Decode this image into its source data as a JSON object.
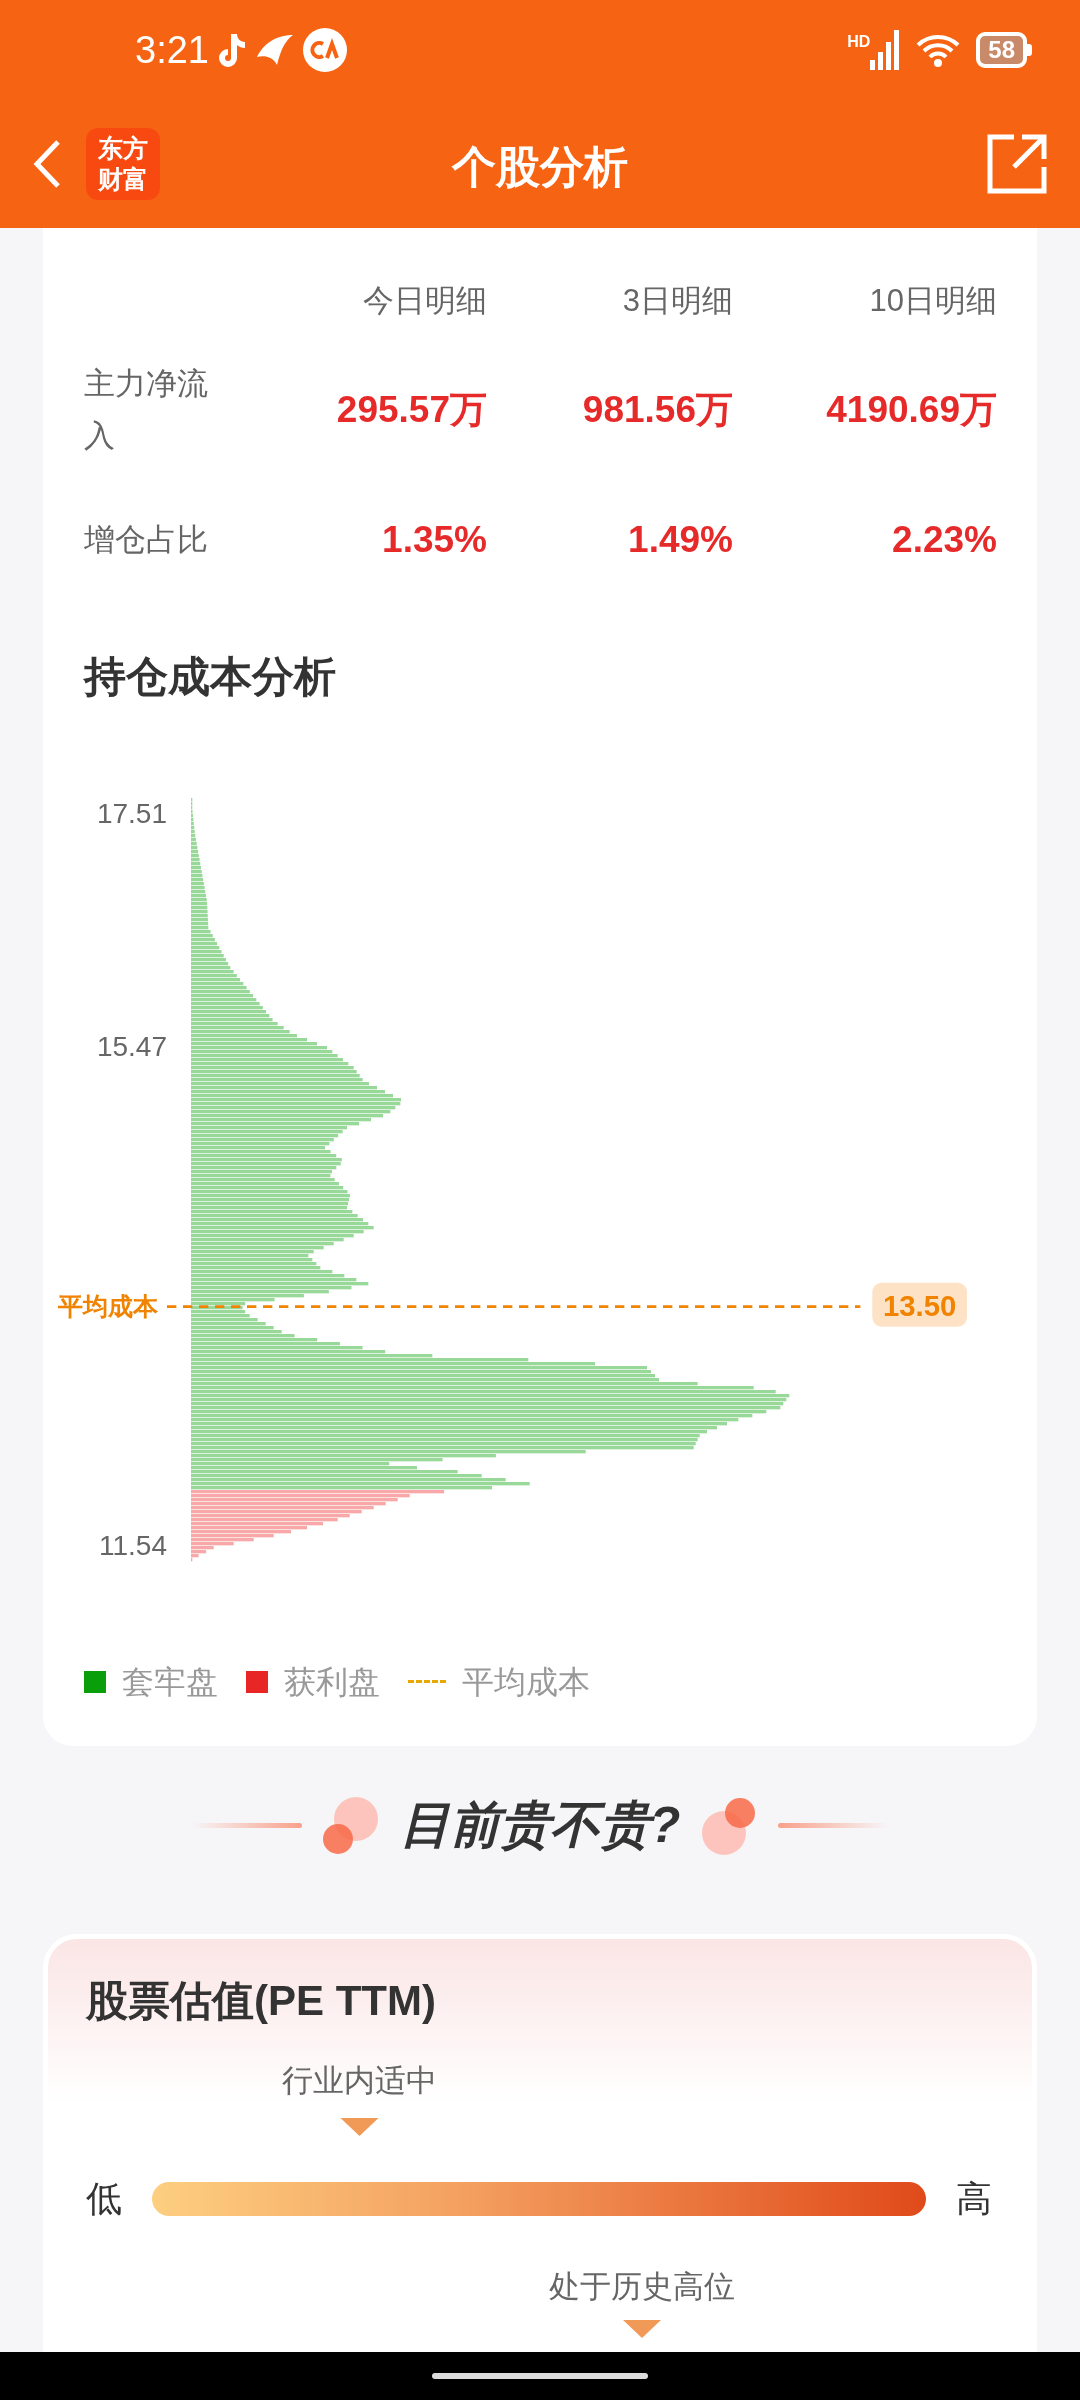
{
  "status_bar": {
    "time": "3:21",
    "network": "HD",
    "battery": "58"
  },
  "header": {
    "logo": "东方财富",
    "title": "个股分析"
  },
  "fund_flow": {
    "columns": [
      "今日明细",
      "3日明细",
      "10日明细"
    ],
    "rows": [
      {
        "label": "主力净流入",
        "values": [
          "295.57万",
          "981.56万",
          "4190.69万"
        ]
      },
      {
        "label": "增仓占比",
        "values": [
          "1.35%",
          "1.49%",
          "2.23%"
        ]
      }
    ]
  },
  "cost_analysis": {
    "title": "持仓成本分析",
    "y_ticks": [
      "17.51",
      "15.47",
      "11.54"
    ],
    "average_cost": {
      "label": "平均成本",
      "value": "13.50"
    },
    "legend": [
      {
        "kind": "square",
        "label": "套牢盘",
        "color": "#0a9e0a"
      },
      {
        "kind": "square",
        "label": "获利盘",
        "color": "#e82626"
      },
      {
        "kind": "dashed",
        "label": "平均成本",
        "color": "#e8a800"
      }
    ]
  },
  "banner": {
    "title": "目前贵不贵?"
  },
  "valuation": {
    "title": "股票估值(PE TTM)",
    "low": "低",
    "high": "高",
    "industry_marker": {
      "label": "行业内适中"
    },
    "history_marker": {
      "label": "处于历史高位"
    }
  }
}
